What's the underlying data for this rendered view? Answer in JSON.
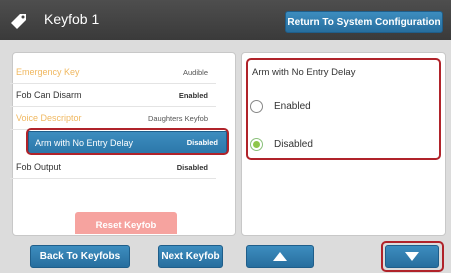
{
  "header": {
    "title": "Keyfob 1",
    "icon": "tag-icon",
    "return_label": "Return To System Configuration"
  },
  "settings": [
    {
      "label": "Emergency Key",
      "value": "Audible",
      "state": "dim"
    },
    {
      "label": "Fob Can Disarm",
      "value": "Enabled",
      "state": "normal"
    },
    {
      "label": "Voice Descriptor",
      "value": "Daughters Keyfob",
      "state": "dim"
    },
    {
      "label": "Arm with No Entry Delay",
      "value": "Disabled",
      "state": "selected"
    },
    {
      "label": "Fob Output",
      "value": "Disabled",
      "state": "normal"
    }
  ],
  "reset_label": "Reset Keyfob",
  "detail": {
    "title": "Arm with No Entry Delay",
    "options": [
      {
        "label": "Enabled",
        "checked": false
      },
      {
        "label": "Disabled",
        "checked": true
      }
    ]
  },
  "footer": {
    "back_label": "Back To Keyfobs",
    "next_label": "Next Keyfob",
    "up_icon": "arrow-up-icon",
    "down_icon": "arrow-down-icon"
  },
  "colors": {
    "accent": "#2c78aa",
    "highlight_outline": "#b0232a",
    "dim_label": "#f0b860",
    "radio_checked": "#8ec64b"
  }
}
